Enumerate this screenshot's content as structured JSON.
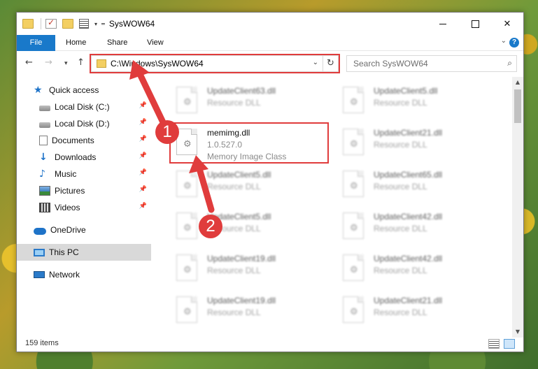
{
  "window": {
    "title": "SysWOW64",
    "controls": {
      "minimize": "",
      "maximize": "",
      "close": "✕"
    }
  },
  "ribbon": {
    "tabs": [
      "File",
      "Home",
      "Share",
      "View"
    ],
    "expand_icon": "chevron-down-icon",
    "help_icon": "?"
  },
  "navigation": {
    "address": "C:\\Windows\\SysWOW64",
    "search_placeholder": "Search SysWOW64"
  },
  "sidebar": {
    "items": [
      {
        "label": "Quick access",
        "icon": "star-icon",
        "pinned": false
      },
      {
        "label": "Local Disk (C:)",
        "icon": "drive-icon",
        "pinned": true
      },
      {
        "label": "Local Disk (D:)",
        "icon": "drive-icon",
        "pinned": true
      },
      {
        "label": "Documents",
        "icon": "documents-icon",
        "pinned": true
      },
      {
        "label": "Downloads",
        "icon": "downloads-icon",
        "pinned": true
      },
      {
        "label": "Music",
        "icon": "music-icon",
        "pinned": true
      },
      {
        "label": "Pictures",
        "icon": "pictures-icon",
        "pinned": true
      },
      {
        "label": "Videos",
        "icon": "videos-icon",
        "pinned": true
      },
      {
        "label": "OneDrive",
        "icon": "onedrive-icon",
        "pinned": false
      },
      {
        "label": "This PC",
        "icon": "this-pc-icon",
        "pinned": false,
        "selected": true
      },
      {
        "label": "Network",
        "icon": "network-icon",
        "pinned": false
      }
    ]
  },
  "files": [
    {
      "name": "UpdateClient63.dll",
      "type": "Resource DLL"
    },
    {
      "name": "UpdateClient5.dll",
      "type": "Resource DLL"
    },
    {
      "name": "memimg.dll",
      "version": "1.0.527.0",
      "description": "Memory Image Class",
      "highlighted": true
    },
    {
      "name": "UpdateClient21.dll",
      "type": "Resource DLL"
    },
    {
      "name": "UpdateClient5.dll",
      "type": "Resource DLL"
    },
    {
      "name": "UpdateClient65.dll",
      "type": "Resource DLL"
    },
    {
      "name": "UpdateClient5.dll",
      "type": "Resource DLL"
    },
    {
      "name": "UpdateClient42.dll",
      "type": "Resource DLL"
    },
    {
      "name": "UpdateClient19.dll",
      "type": "Resource DLL"
    },
    {
      "name": "UpdateClient42.dll",
      "type": "Resource DLL"
    },
    {
      "name": "UpdateClient19.dll",
      "type": "Resource DLL"
    },
    {
      "name": "UpdateClient21.dll",
      "type": "Resource DLL"
    }
  ],
  "status": {
    "item_count": "159 items"
  },
  "callouts": [
    "1",
    "2"
  ],
  "colors": {
    "accent": "#1979ca",
    "highlight": "#e03c3c",
    "selected_nav": "#d9d9d9"
  }
}
